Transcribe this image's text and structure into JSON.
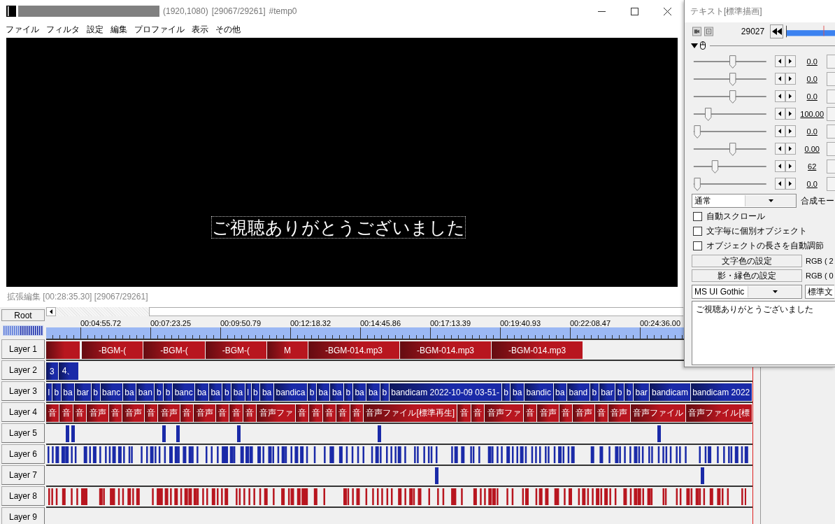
{
  "window": {
    "title_parts": [
      "(1920,1080)",
      "[29067/29261]",
      "#temp0"
    ]
  },
  "menu": [
    "ファイル",
    "フィルタ",
    "設定",
    "編集",
    "プロファイル",
    "表示",
    "その他"
  ],
  "preview": {
    "caption": "ご視聴ありがとうございました"
  },
  "timeline": {
    "status": "拡張編集 [00:28:35.30] [29067/29261]",
    "root_button": "Root",
    "ruler": [
      "00:04:55.72",
      "00:07:23.25",
      "00:09:50.79",
      "00:12:18.32",
      "00:14:45.86",
      "00:17:13.39",
      "00:19:40.93",
      "00:22:08.47",
      "00:24:36.00"
    ],
    "layers": [
      {
        "name": "Layer 1",
        "kind": "wide",
        "color": "#b8161f",
        "clips": [
          {
            "kind": "blank"
          },
          {
            "kind": "labeled",
            "label": "-BGM-("
          },
          {
            "kind": "labeled",
            "label": "-BGM-("
          },
          {
            "kind": "labeled",
            "label": "-BGM-("
          },
          {
            "kind": "labeled",
            "label": "M"
          },
          {
            "kind": "labeled",
            "label": "-BGM-014.mp3"
          },
          {
            "kind": "labeled",
            "label": "-BGM-014.mp3"
          },
          {
            "kind": "labeled",
            "label": "-BGM-014.mp3"
          }
        ]
      },
      {
        "name": "Layer 2",
        "kind": "narrow",
        "color": "#1a2aa8",
        "clips": [
          {
            "kind": "labeled",
            "label": "3"
          },
          {
            "kind": "labeled",
            "label": "4、"
          }
        ]
      },
      {
        "name": "Layer 3",
        "kind": "fill",
        "color": "#1a2aa8",
        "clips": [
          {
            "kind": "labeled",
            "label": "l"
          },
          {
            "kind": "labeled",
            "label": "b"
          },
          {
            "kind": "labeled",
            "label": "ba"
          },
          {
            "kind": "labeled",
            "label": "bar"
          },
          {
            "kind": "labeled",
            "label": "b"
          },
          {
            "kind": "labeled",
            "label": "banc"
          },
          {
            "kind": "labeled",
            "label": "ba"
          },
          {
            "kind": "labeled",
            "label": "ban"
          },
          {
            "kind": "labeled",
            "label": "b"
          },
          {
            "kind": "labeled",
            "label": "b"
          },
          {
            "kind": "labeled",
            "label": "banc"
          },
          {
            "kind": "labeled",
            "label": "ba"
          },
          {
            "kind": "labeled",
            "label": "ba"
          },
          {
            "kind": "labeled",
            "label": "b"
          },
          {
            "kind": "labeled",
            "label": "ba"
          },
          {
            "kind": "labeled",
            "label": "l"
          },
          {
            "kind": "labeled",
            "label": "b"
          },
          {
            "kind": "labeled",
            "label": "ba"
          },
          {
            "kind": "labeled",
            "label": "bandica"
          },
          {
            "kind": "labeled",
            "label": "b"
          },
          {
            "kind": "labeled",
            "label": "ba"
          },
          {
            "kind": "labeled",
            "label": "ba"
          },
          {
            "kind": "labeled",
            "label": "b"
          },
          {
            "kind": "labeled",
            "label": "ba"
          },
          {
            "kind": "labeled",
            "label": "ba"
          },
          {
            "kind": "labeled",
            "label": "b"
          },
          {
            "kind": "labeled",
            "label": "bandicam 2022-10-09 03-51-"
          },
          {
            "kind": "labeled",
            "label": "b"
          },
          {
            "kind": "labeled",
            "label": "ba"
          },
          {
            "kind": "labeled",
            "label": "bandic"
          },
          {
            "kind": "labeled",
            "label": "ba"
          },
          {
            "kind": "labeled",
            "label": "band"
          },
          {
            "kind": "labeled",
            "label": "b"
          },
          {
            "kind": "labeled",
            "label": "bar"
          },
          {
            "kind": "labeled",
            "label": "b"
          },
          {
            "kind": "labeled",
            "label": "b"
          },
          {
            "kind": "labeled",
            "label": "bar"
          },
          {
            "kind": "labeled",
            "label": "bandicam"
          },
          {
            "kind": "labeled",
            "label": "bandicam 2022"
          }
        ]
      },
      {
        "name": "Layer 4",
        "kind": "fill",
        "color": "#b8161f",
        "clips": [
          {
            "kind": "labeled",
            "label": "音"
          },
          {
            "kind": "labeled",
            "label": "音"
          },
          {
            "kind": "labeled",
            "label": "音"
          },
          {
            "kind": "labeled",
            "label": "音声"
          },
          {
            "kind": "labeled",
            "label": "音"
          },
          {
            "kind": "labeled",
            "label": "音声"
          },
          {
            "kind": "labeled",
            "label": "音"
          },
          {
            "kind": "labeled",
            "label": "音声"
          },
          {
            "kind": "labeled",
            "label": "音"
          },
          {
            "kind": "labeled",
            "label": "音声"
          },
          {
            "kind": "labeled",
            "label": "音"
          },
          {
            "kind": "labeled",
            "label": "音"
          },
          {
            "kind": "labeled",
            "label": "音"
          },
          {
            "kind": "labeled",
            "label": "音声ファ"
          },
          {
            "kind": "labeled",
            "label": "音"
          },
          {
            "kind": "labeled",
            "label": "音"
          },
          {
            "kind": "labeled",
            "label": "音"
          },
          {
            "kind": "labeled",
            "label": "音"
          },
          {
            "kind": "labeled",
            "label": "音"
          },
          {
            "kind": "labeled",
            "label": "音声ファイル[標準再生]"
          },
          {
            "kind": "labeled",
            "label": "音"
          },
          {
            "kind": "labeled",
            "label": "音"
          },
          {
            "kind": "labeled",
            "label": "音声ファ"
          },
          {
            "kind": "labeled",
            "label": "音"
          },
          {
            "kind": "labeled",
            "label": "音声"
          },
          {
            "kind": "labeled",
            "label": "音"
          },
          {
            "kind": "labeled",
            "label": "音声"
          },
          {
            "kind": "labeled",
            "label": "音"
          },
          {
            "kind": "labeled",
            "label": "音声"
          },
          {
            "kind": "labeled",
            "label": "音声ファイル"
          },
          {
            "kind": "labeled",
            "label": "音声ファイル[標"
          }
        ]
      },
      {
        "name": "Layer 5",
        "kind": "sparse",
        "color": "#1a2aa8"
      },
      {
        "name": "Layer 6",
        "kind": "dense",
        "color": "#1a2aa8"
      },
      {
        "name": "Layer 7",
        "kind": "rare",
        "color": "#1a2aa8"
      },
      {
        "name": "Layer 8",
        "kind": "dense",
        "color": "#b8161f"
      },
      {
        "name": "Layer 9",
        "kind": "empty"
      }
    ]
  },
  "properties": {
    "title": "テキスト[標準描画]",
    "frame": "29027",
    "tracks": [
      {
        "level": 0.55,
        "value": "0.0"
      },
      {
        "level": 0.55,
        "value": "0.0"
      },
      {
        "level": 0.55,
        "value": "0.0"
      },
      {
        "level": 0.19,
        "value": "100.00"
      },
      {
        "level": 0.03,
        "value": "0.0"
      },
      {
        "level": 0.55,
        "value": "0.00"
      },
      {
        "level": 0.29,
        "value": "62"
      },
      {
        "level": 0.03,
        "value": "0.0"
      }
    ],
    "blend": {
      "value": "通常",
      "label": "合成モー"
    },
    "options": [
      {
        "label": "自動スクロール",
        "checked": false
      },
      {
        "label": "文字毎に個別オブジェクト",
        "checked": false
      },
      {
        "label": "オブジェクトの長さを自動調節",
        "checked": false
      }
    ],
    "color_buttons": [
      {
        "label": "文字色の設定",
        "value": "RGB ( 2"
      },
      {
        "label": "影・縁色の設定",
        "value": "RGB ( 0"
      }
    ],
    "font": {
      "value": "MS UI Gothic",
      "style": "標準文"
    },
    "text": "ご視聴ありがとうございました"
  }
}
